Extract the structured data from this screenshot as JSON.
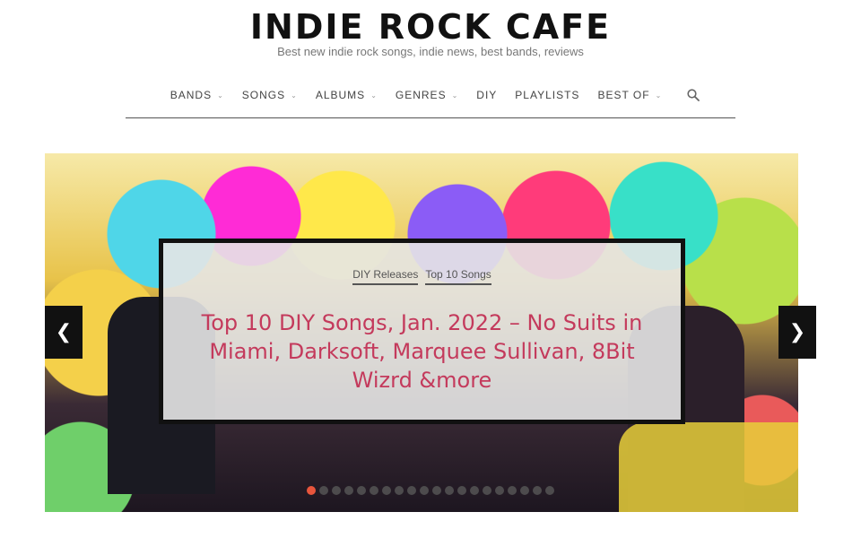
{
  "header": {
    "title": "INDIE ROCK CAFE",
    "tagline": "Best new indie rock songs, indie news, best bands, reviews"
  },
  "nav": {
    "items": [
      {
        "label": "BANDS",
        "dropdown": true
      },
      {
        "label": "SONGS",
        "dropdown": true
      },
      {
        "label": "ALBUMS",
        "dropdown": true
      },
      {
        "label": "GENRES",
        "dropdown": true
      },
      {
        "label": "DIY",
        "dropdown": false
      },
      {
        "label": "PLAYLISTS",
        "dropdown": false
      },
      {
        "label": "BEST OF",
        "dropdown": true
      }
    ],
    "search_icon": "search-icon"
  },
  "slider": {
    "categories": [
      "DIY Releases",
      "Top 10 Songs"
    ],
    "title": "Top 10 DIY Songs, Jan. 2022 – No Suits in Miami, Darksoft, Marquee Sullivan, 8Bit Wizrd &more",
    "prev_glyph": "❮",
    "next_glyph": "❯",
    "dot_count": 20,
    "active_dot": 0,
    "accent_color": "#c43a5c",
    "active_dot_color": "#e8553c"
  }
}
